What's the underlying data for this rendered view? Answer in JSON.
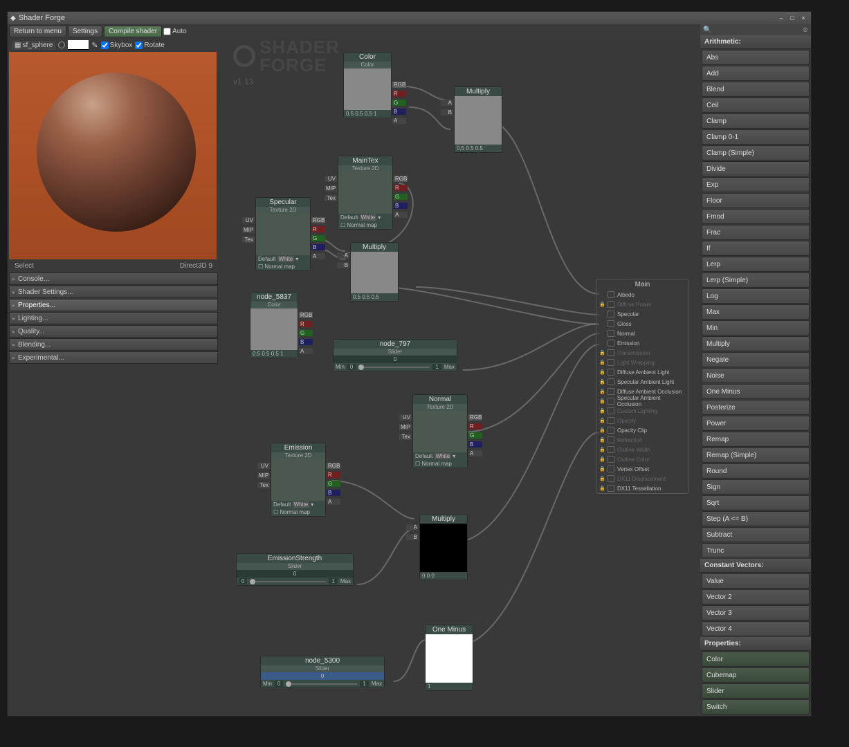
{
  "window": {
    "title": "Shader Forge"
  },
  "toolbar": {
    "return": "Return to menu",
    "settings": "Settings",
    "compile": "Compile shader",
    "auto": "Auto"
  },
  "toolbar2": {
    "object": "sf_sphere",
    "skybox": "Skybox",
    "rotate": "Rotate"
  },
  "brand": {
    "line1": "SHADER",
    "line2": "FORGE",
    "version": "v1.13"
  },
  "status": {
    "left": "Select",
    "right": "Direct3D 9"
  },
  "sidepanels": [
    "Console...",
    "Shader Settings...",
    "Properties...",
    "Lighting...",
    "Quality...",
    "Blending...",
    "Experimental..."
  ],
  "sidepanel_selected": 2,
  "nodes": {
    "color": {
      "title": "Color",
      "sub": "Color",
      "foot": "0.5  0.5  0.5  1"
    },
    "maintex": {
      "title": "MainTex",
      "sub": "Texture 2D",
      "default": "Default",
      "defval": "White",
      "normal": "Normal map"
    },
    "specular": {
      "title": "Specular",
      "sub": "Texture 2D",
      "default": "Default",
      "defval": "White",
      "normal": "Normal map"
    },
    "node5837": {
      "title": "node_5837",
      "sub": "Color",
      "foot": "0.5  0.5  0.5  1"
    },
    "multiply1": {
      "title": "Multiply",
      "foot": "0.5   0.5   0.5"
    },
    "multiply2": {
      "title": "Multiply",
      "foot": "0.5    0.5    0.5"
    },
    "node797": {
      "title": "node_797",
      "sub": "Slider",
      "val": "0",
      "min": "Min",
      "minv": "0",
      "max": "Max",
      "maxv": "1"
    },
    "normal": {
      "title": "Normal",
      "sub": "Texture 2D",
      "default": "Default",
      "defval": "White",
      "normal": "Normal map"
    },
    "emission": {
      "title": "Emission",
      "sub": "Texture 2D",
      "default": "Default",
      "defval": "White",
      "normal": "Normal map"
    },
    "emstrength": {
      "title": "EmissionStrength",
      "sub": "Slider",
      "val": "0",
      "minv": "0",
      "maxv": "1",
      "max": "Max"
    },
    "multiply3": {
      "title": "Multiply",
      "foot": "0      0      0"
    },
    "oneminus": {
      "title": "One Minus",
      "foot": "1"
    },
    "node5300": {
      "title": "node_5300",
      "sub": "Slider",
      "val": "0",
      "min": "Min",
      "minv": "0",
      "maxv": "1",
      "max": "Max"
    }
  },
  "main": {
    "title": "Main",
    "rows": [
      {
        "label": "Albedo",
        "dim": false,
        "locked": false
      },
      {
        "label": "Diffuse Power",
        "dim": true,
        "locked": true
      },
      {
        "label": "Specular",
        "dim": false,
        "locked": false
      },
      {
        "label": "Gloss",
        "dim": false,
        "locked": false
      },
      {
        "label": "Normal",
        "dim": false,
        "locked": false
      },
      {
        "label": "Emission",
        "dim": false,
        "locked": false
      },
      {
        "label": "Transmission",
        "dim": true,
        "locked": true
      },
      {
        "label": "Light Wrapping",
        "dim": true,
        "locked": true
      },
      {
        "label": "Diffuse Ambient Light",
        "dim": false,
        "locked": true
      },
      {
        "label": "Specular Ambient Light",
        "dim": false,
        "locked": true
      },
      {
        "label": "Diffuse Ambient Occlusion",
        "dim": false,
        "locked": true
      },
      {
        "label": "Specular Ambient Occlusion",
        "dim": false,
        "locked": true
      },
      {
        "label": "Custom Lighting",
        "dim": true,
        "locked": true
      },
      {
        "label": "Opacity",
        "dim": true,
        "locked": true
      },
      {
        "label": "Opacity Clip",
        "dim": false,
        "locked": true
      },
      {
        "label": "Refraction",
        "dim": true,
        "locked": true
      },
      {
        "label": "Outline Width",
        "dim": true,
        "locked": true
      },
      {
        "label": "Outline Color",
        "dim": true,
        "locked": true
      },
      {
        "label": "Vertex Offset",
        "dim": false,
        "locked": true
      },
      {
        "label": "DX11 Displacement",
        "dim": true,
        "locked": true
      },
      {
        "label": "DX11 Tessellation",
        "dim": false,
        "locked": true
      }
    ]
  },
  "rightcats": [
    {
      "title": "Arithmetic:",
      "items": [
        "Abs",
        "Add",
        "Blend",
        "Ceil",
        "Clamp",
        "Clamp 0-1",
        "Clamp (Simple)",
        "Divide",
        "Exp",
        "Floor",
        "Fmod",
        "Frac",
        "If",
        "Lerp",
        "Lerp (Simple)",
        "Log",
        "Max",
        "Min",
        "Multiply",
        "Negate",
        "Noise",
        "One Minus",
        "Posterize",
        "Power",
        "Remap",
        "Remap (Simple)",
        "Round",
        "Sign",
        "Sqrt",
        "Step (A <= B)",
        "Subtract",
        "Trunc"
      ]
    },
    {
      "title": "Constant Vectors:",
      "items": [
        "Value",
        "Vector 2",
        "Vector 3",
        "Vector 4"
      ]
    },
    {
      "title": "Properties:",
      "items": [
        "Color",
        "Cubemap",
        "Slider",
        "Switch"
      ],
      "prop": true
    }
  ],
  "portlabels": {
    "uv": "UV",
    "mip": "MIP",
    "tex": "Tex",
    "rgb": "RGB",
    "r": "R",
    "g": "G",
    "b": "B",
    "a": "A"
  }
}
